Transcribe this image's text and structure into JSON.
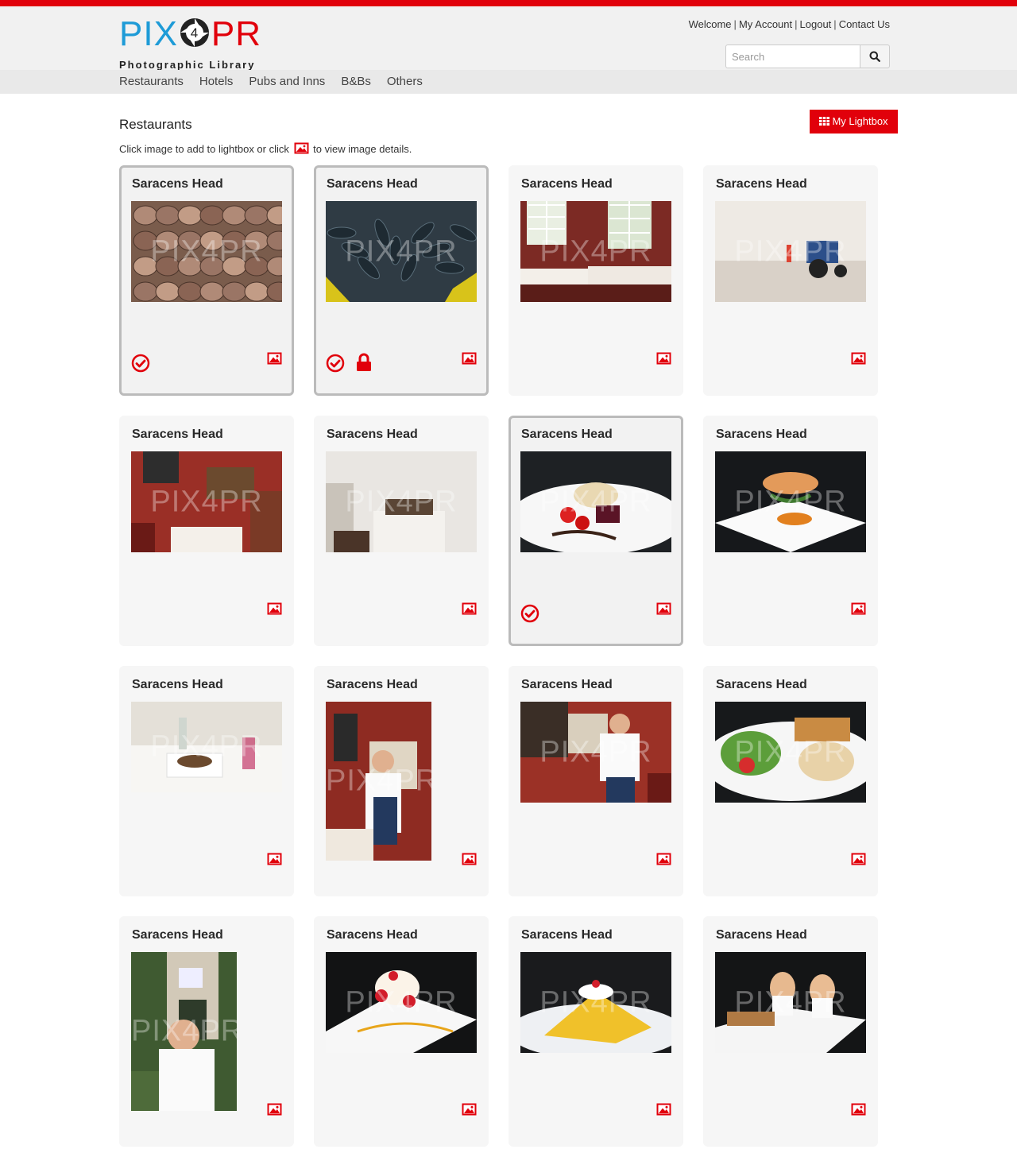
{
  "brand": {
    "logo_left": "PIX",
    "logo_mid": "4",
    "logo_right": "PR",
    "logo_sub": "Photographic Library",
    "accent": "#e1000b",
    "blue": "#1e9bd7"
  },
  "toplinks": {
    "welcome": "Welcome",
    "account": "My Account",
    "logout": "Logout",
    "contact": "Contact Us"
  },
  "search": {
    "placeholder": "Search",
    "icon": "search-icon"
  },
  "nav": [
    {
      "label": "Restaurants"
    },
    {
      "label": "Hotels"
    },
    {
      "label": "Pubs and Inns"
    },
    {
      "label": "B&Bs"
    },
    {
      "label": "Others"
    }
  ],
  "page": {
    "title": "Restaurants",
    "lightbox_label": "My Lightbox",
    "instructions_before": "Click image to add to lightbox or click",
    "instructions_after": "to view image details."
  },
  "watermark": "PIX4PR",
  "cards": [
    {
      "title": "Saracens Head",
      "scene": "crabs",
      "selected": true,
      "locked": false
    },
    {
      "title": "Saracens Head",
      "scene": "lobsters",
      "selected": true,
      "locked": true
    },
    {
      "title": "Saracens Head",
      "scene": "dining-room",
      "selected": false,
      "locked": false
    },
    {
      "title": "Saracens Head",
      "scene": "beach-tractor",
      "selected": false,
      "locked": false
    },
    {
      "title": "Saracens Head",
      "scene": "red-dining-room",
      "selected": false,
      "locked": false
    },
    {
      "title": "Saracens Head",
      "scene": "bedroom",
      "selected": false,
      "locked": false
    },
    {
      "title": "Saracens Head",
      "scene": "plated-dish",
      "selected": true,
      "locked": false
    },
    {
      "title": "Saracens Head",
      "scene": "salmon-dish",
      "selected": false,
      "locked": false
    },
    {
      "title": "Saracens Head",
      "scene": "table-setting",
      "selected": false,
      "locked": false
    },
    {
      "title": "Saracens Head",
      "scene": "chef-portrait",
      "selected": false,
      "locked": false
    },
    {
      "title": "Saracens Head",
      "scene": "chef-bar",
      "selected": false,
      "locked": false
    },
    {
      "title": "Saracens Head",
      "scene": "salad-plate",
      "selected": false,
      "locked": false
    },
    {
      "title": "Saracens Head",
      "scene": "chef-outside",
      "selected": false,
      "locked": false
    },
    {
      "title": "Saracens Head",
      "scene": "strawberry-dessert",
      "selected": false,
      "locked": false
    },
    {
      "title": "Saracens Head",
      "scene": "tart-dessert",
      "selected": false,
      "locked": false
    },
    {
      "title": "Saracens Head",
      "scene": "eggs-breakfast",
      "selected": false,
      "locked": false
    }
  ]
}
